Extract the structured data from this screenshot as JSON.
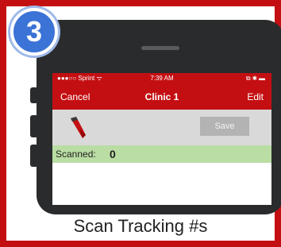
{
  "badge": {
    "number": "3"
  },
  "status_bar": {
    "carrier": "●●●○○ Sprint ᯤ",
    "time": "7:39 AM",
    "battery": "⧉ ✱ ▬"
  },
  "nav": {
    "cancel": "Cancel",
    "title": "Clinic 1",
    "edit": "Edit"
  },
  "toolbar": {
    "save": "Save",
    "scanner_icon": "barcode-scanner-icon"
  },
  "scanned": {
    "label": "Scanned:",
    "count": "0"
  },
  "caption": "Scan Tracking #s",
  "colors": {
    "brand_red": "#c40f12",
    "badge_blue": "#3b73d6",
    "scanned_green": "#b9dda3",
    "toolbar_gray": "#d9d9d9"
  }
}
